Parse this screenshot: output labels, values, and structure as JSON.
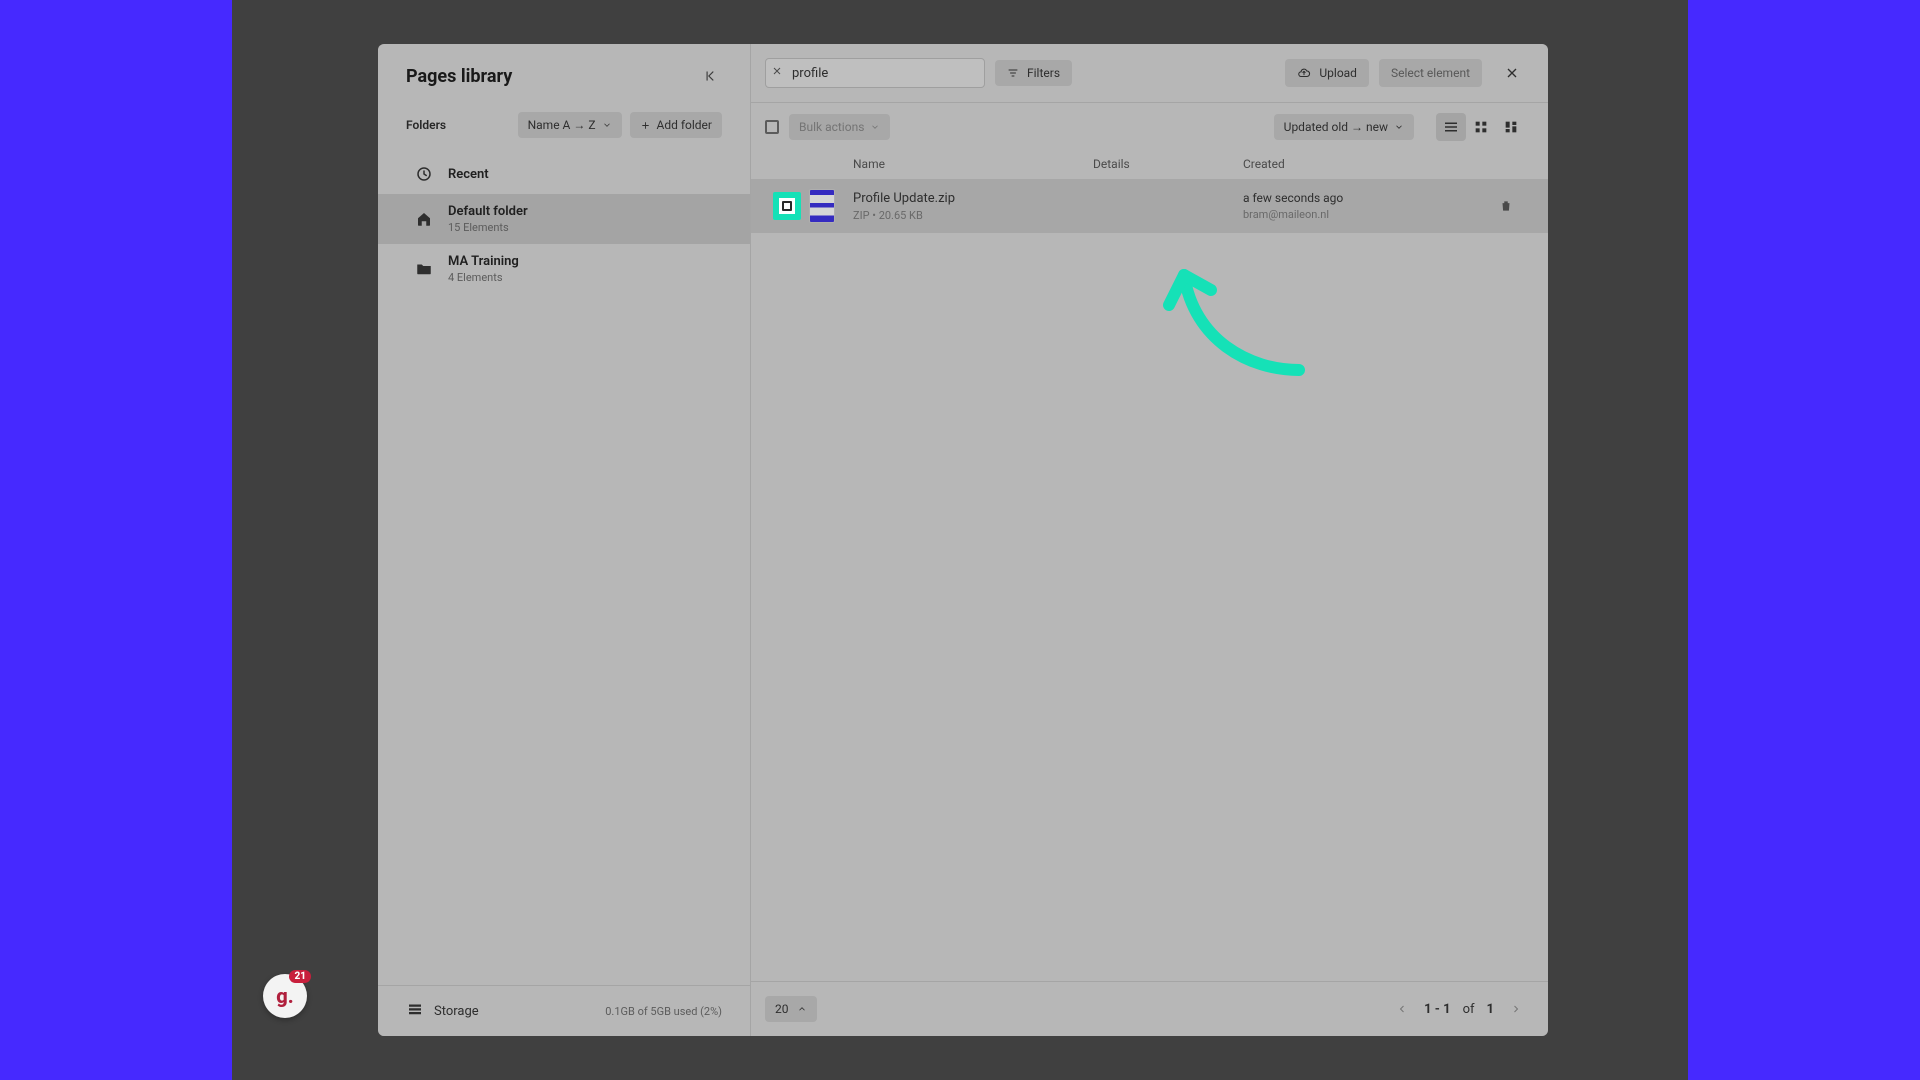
{
  "colors": {
    "accent": "#4629ff",
    "highlight": "#15e1b7"
  },
  "badge": {
    "glyph": "g.",
    "count": "21"
  },
  "header": {
    "title": "Pages library"
  },
  "sidebar": {
    "section_label": "Folders",
    "sort_label": "Name A → Z",
    "add_folder_label": "Add folder",
    "items": [
      {
        "icon": "clock",
        "name": "Recent",
        "sub": ""
      },
      {
        "icon": "home",
        "name": "Default folder",
        "sub": "15 Elements"
      },
      {
        "icon": "folder",
        "name": "MA Training",
        "sub": "4 Elements"
      }
    ],
    "storage_label": "Storage",
    "storage_usage": "0.1GB of 5GB used (2%)"
  },
  "toolbar": {
    "search_value": "profile",
    "filters_label": "Filters",
    "upload_label": "Upload",
    "select_element_label": "Select element"
  },
  "list": {
    "bulk_label": "Bulk actions",
    "sort_label": "Updated old → new",
    "columns": {
      "name": "Name",
      "details": "Details",
      "created": "Created"
    },
    "rows": [
      {
        "filename": "Profile Update.zip",
        "meta": "ZIP • 20.65 KB",
        "created_when": "a few seconds ago",
        "created_by": "bram@maileon.nl"
      }
    ]
  },
  "footer": {
    "page_size": "20",
    "range": "1 - 1",
    "of_label": "of",
    "total": "1"
  }
}
